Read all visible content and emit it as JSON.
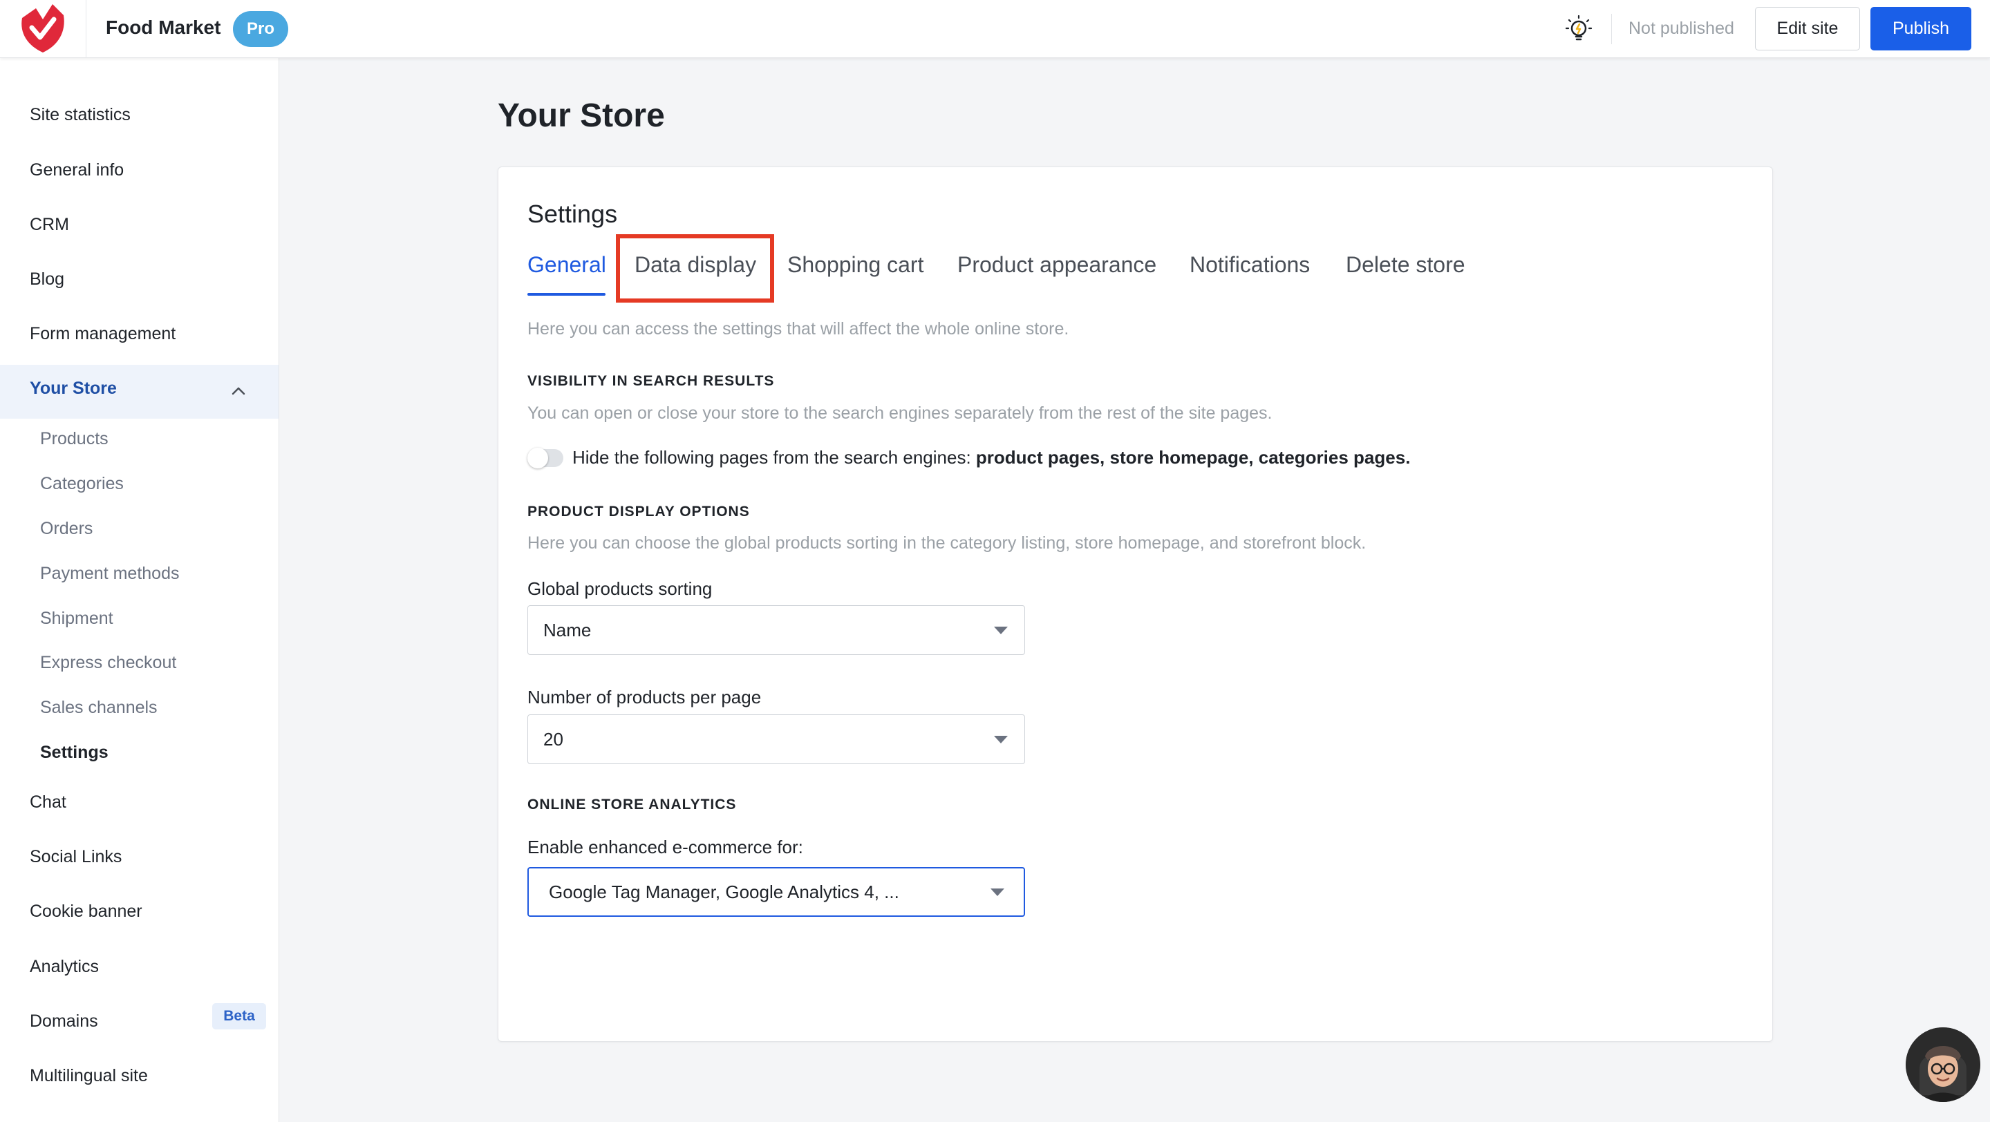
{
  "header": {
    "brand": "Food Market",
    "plan_badge": "Pro",
    "status": "Not published",
    "edit_label": "Edit site",
    "publish_label": "Publish"
  },
  "colors": {
    "brand_red": "#e0283a",
    "accent_blue": "#1f5ae0",
    "highlight_red": "#e53a24"
  },
  "sidebar": {
    "items": [
      "Site statistics",
      "General info",
      "CRM",
      "Blog",
      "Form management",
      "Your Store"
    ],
    "store_subitems": [
      "Products",
      "Categories",
      "Orders",
      "Payment methods",
      "Shipment",
      "Express checkout",
      "Sales channels",
      "Settings"
    ],
    "items_after": [
      "Chat",
      "Social Links",
      "Cookie banner",
      "Analytics",
      "Domains",
      "Multilingual site"
    ],
    "beta_badge": "Beta"
  },
  "main": {
    "page_title": "Your Store",
    "settings_title": "Settings",
    "tabs": [
      "General",
      "Data display",
      "Shopping cart",
      "Product appearance",
      "Notifications",
      "Delete store"
    ],
    "intro": "Here you can access the settings that will affect the whole online store.",
    "visibility": {
      "heading": "VISIBILITY IN SEARCH RESULTS",
      "description": "You can open or close your store to the search engines separately from the rest of the site pages.",
      "toggle_text": "Hide the following pages from the search engines: ",
      "toggle_bold": "product pages, store homepage, categories pages."
    },
    "product_display": {
      "heading": "PRODUCT DISPLAY OPTIONS",
      "description": "Here you can choose the global products sorting in the category listing, store homepage, and storefront block.",
      "sorting_label": "Global products sorting",
      "sorting_value": "Name",
      "per_page_label": "Number of products per page",
      "per_page_value": "20"
    },
    "analytics": {
      "heading": "ONLINE STORE ANALYTICS",
      "label": "Enable enhanced e-commerce for:",
      "value": "Google Tag Manager, Google Analytics 4, ..."
    }
  }
}
